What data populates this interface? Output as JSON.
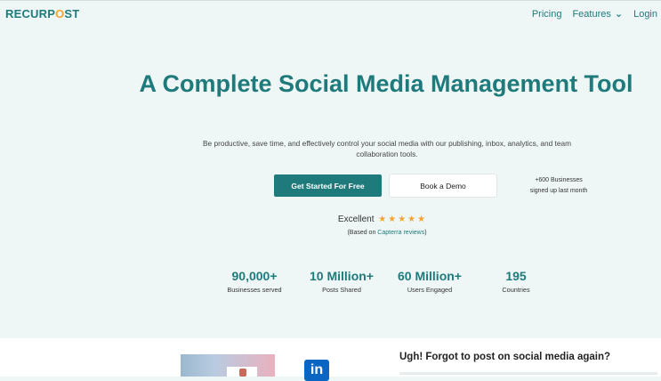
{
  "header": {
    "logo_prefix": "RECURP",
    "logo_o": "O",
    "logo_suffix": "ST",
    "nav": {
      "pricing": "Pricing",
      "features": "Features",
      "login": "Login"
    }
  },
  "hero": {
    "title": "A Complete Social Media Management Tool",
    "subtitle": "Be productive, save time, and effectively control your social media with our publishing, inbox, analytics, and team collaboration tools.",
    "cta_primary": "Get Started For Free",
    "cta_secondary": "Book a Demo",
    "signed_up_line1": "+600 Businesses",
    "signed_up_line2": "signed up last month",
    "rating_label": "Excellent",
    "stars": "★★★★★",
    "based_prefix": "(Based on ",
    "based_link": "Capterra reviews",
    "based_suffix": ")"
  },
  "stats": [
    {
      "value": "90,000+",
      "label": "Businesses served"
    },
    {
      "value": "10 Million+",
      "label": "Posts Shared"
    },
    {
      "value": "60 Million+",
      "label": "Users Engaged"
    },
    {
      "value": "195",
      "label": "Countries"
    }
  ],
  "section2": {
    "heading": "Ugh! Forgot to post on social media again?",
    "linkedin_icon_text": "in"
  },
  "colors": {
    "brand": "#1f7a7c",
    "accent": "#f4a432",
    "background": "#eef7f6"
  }
}
